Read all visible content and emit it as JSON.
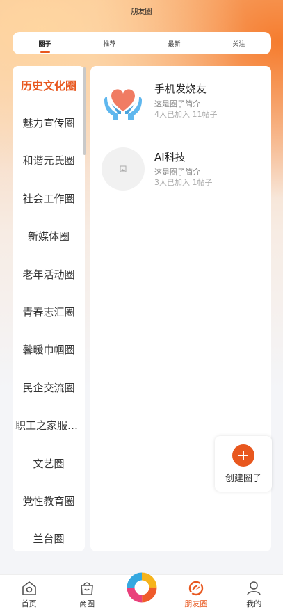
{
  "header": {
    "title": "朋友圈"
  },
  "tabs": [
    {
      "label": "圈子",
      "active": true
    },
    {
      "label": "推荐",
      "active": false
    },
    {
      "label": "最新",
      "active": false
    },
    {
      "label": "关注",
      "active": false
    }
  ],
  "sidebar": {
    "items": [
      {
        "label": "历史文化圈",
        "active": true
      },
      {
        "label": "魅力宣传圈"
      },
      {
        "label": "和谐元氏圈"
      },
      {
        "label": "社会工作圈"
      },
      {
        "label": "新媒体圈"
      },
      {
        "label": "老年活动圈"
      },
      {
        "label": "青春志汇圈"
      },
      {
        "label": "馨暖巾帼圈"
      },
      {
        "label": "民企交流圈"
      },
      {
        "label": "职工之家服务圈"
      },
      {
        "label": "文艺圈"
      },
      {
        "label": "党性教育圈"
      },
      {
        "label": "兰台圈"
      }
    ]
  },
  "circles": [
    {
      "name": "手机发烧友",
      "desc": "这是圈子简介",
      "stats": "4人已加入 11帖子",
      "icon": "heart-hands-icon"
    },
    {
      "name": "AI科技",
      "desc": "这是圈子简介",
      "stats": "3人已加入 1帖子",
      "icon": "image-placeholder-icon"
    }
  ],
  "create_button": {
    "label": "创建圈子"
  },
  "bottom_nav": {
    "items": [
      {
        "label": "首页",
        "icon": "home-icon"
      },
      {
        "label": "商圈",
        "icon": "shopping-bag-icon"
      },
      {
        "label": "朋友圈",
        "icon": "friends-circle-icon",
        "active": true
      },
      {
        "label": "我的",
        "icon": "user-icon"
      }
    ]
  },
  "colors": {
    "accent": "#e8571e",
    "gradient_orange": "#f5782a",
    "gradient_peach": "#ffd6a0"
  }
}
